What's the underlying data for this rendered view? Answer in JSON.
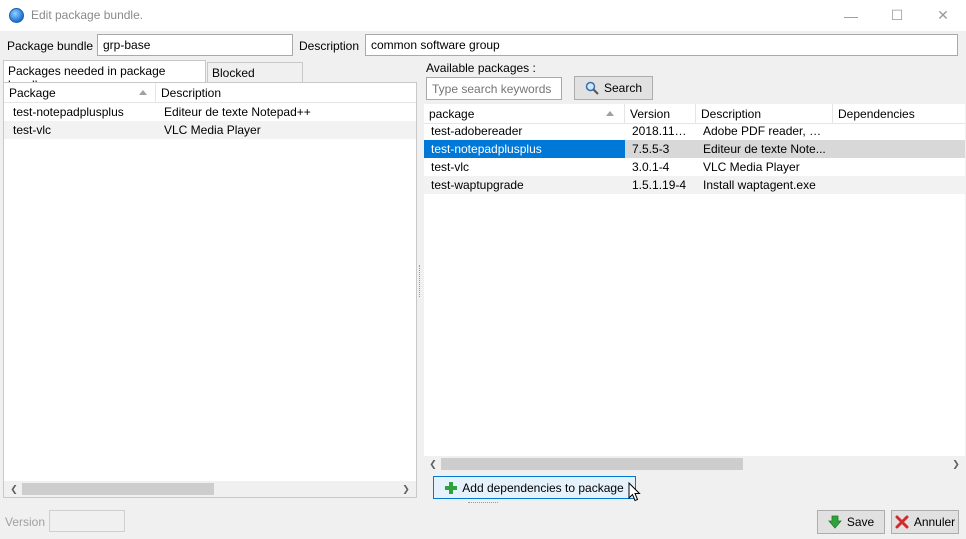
{
  "window": {
    "title": "Edit package bundle.",
    "minimize_glyph": "—",
    "maximize_glyph": "☐",
    "close_glyph": "✕"
  },
  "form": {
    "bundle_label": "Package bundle",
    "bundle_value": "grp-base",
    "description_label": "Description",
    "description_value": "common software group"
  },
  "tabs": [
    {
      "label": "Packages needed in package bundle",
      "active": true
    },
    {
      "label": "Blocked package",
      "active": false
    }
  ],
  "needed_grid": {
    "columns": [
      "Package",
      "Description"
    ],
    "rows": [
      [
        "test-notepadplusplus",
        "Editeur de texte Notepad++"
      ],
      [
        "test-vlc",
        "VLC Media Player"
      ]
    ]
  },
  "available": {
    "label": "Available packages :",
    "search_placeholder": "Type search keywords",
    "search_button": "Search",
    "columns": [
      "package",
      "Version",
      "Description",
      "Dependencies"
    ],
    "rows": [
      [
        "test-adobereader",
        "2018.11.2...",
        "Adobe PDF reader, no...",
        ""
      ],
      [
        "test-notepadplusplus",
        "7.5.5-3",
        "Editeur de texte Note...",
        ""
      ],
      [
        "test-vlc",
        "3.0.1-4",
        "VLC Media Player",
        ""
      ],
      [
        "test-waptupgrade",
        "1.5.1.19-4",
        "Install waptagent.exe",
        ""
      ]
    ],
    "selected_row": 1
  },
  "actions": {
    "add_dependencies": "Add dependencies to package",
    "version_label": "Version",
    "save": "Save",
    "cancel": "Annuler"
  },
  "colors": {
    "selection": "#0078d7",
    "accent_green": "#2fa33b",
    "cancel_red": "#d22b2b"
  }
}
